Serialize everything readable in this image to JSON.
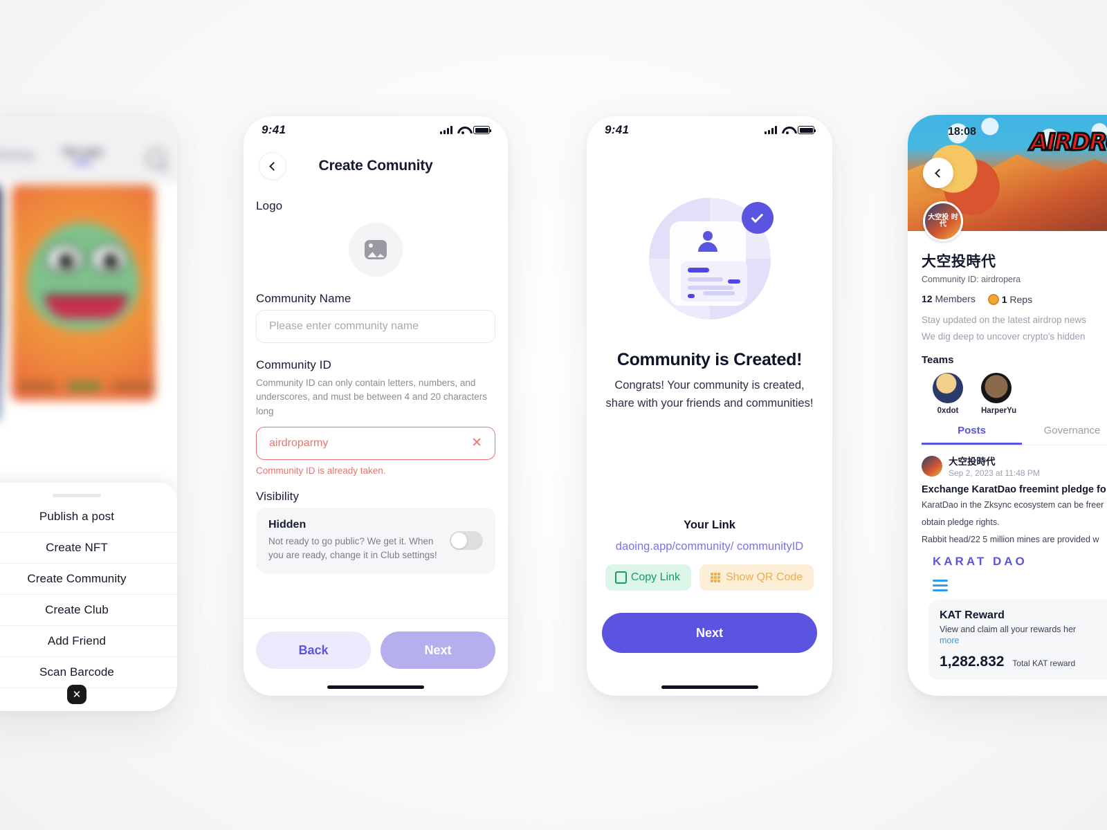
{
  "screen_feed": {
    "status": {
      "time": "",
      "icons": [
        "signal-icon",
        "wifi-icon",
        "battery-icon"
      ]
    },
    "tabs": [
      {
        "label": "Following",
        "active": false
      },
      {
        "label": "For you",
        "active": true
      }
    ],
    "search_icon": "search-icon",
    "sheet": {
      "items": [
        {
          "label": "Publish a post"
        },
        {
          "label": "Create NFT"
        },
        {
          "label": "Create Community"
        },
        {
          "label": "Create Club"
        },
        {
          "label": "Add Friend"
        },
        {
          "label": "Scan Barcode"
        }
      ],
      "close_label": "✕"
    }
  },
  "screen_create": {
    "status": {
      "time": "9:41"
    },
    "nav": {
      "back_icon": "chevron-left-icon",
      "title": "Create Comunity"
    },
    "logo": {
      "label": "Logo",
      "placeholder_icon": "image-placeholder-icon"
    },
    "community_name": {
      "label": "Community Name",
      "placeholder": "Please enter community name",
      "value": ""
    },
    "community_id": {
      "label": "Community ID",
      "hint": "Community ID can only contain letters, numbers, and underscores, and must be between 4 and 20 characters long",
      "value": "airdroparmy",
      "clear_icon": "✕",
      "error": "Community ID is already taken."
    },
    "visibility": {
      "label": "Visibility",
      "option_title": "Hidden",
      "option_sub": "Not ready to go public? We get it. When you are ready, change it in Club settings!",
      "toggle_state": "off"
    },
    "footer": {
      "back_label": "Back",
      "next_label": "Next"
    },
    "colors": {
      "accent": "#5b54e0",
      "error": "#e8746f",
      "next_soft": "#b5afee",
      "back_bg": "#eceafc"
    }
  },
  "screen_done": {
    "status": {
      "time": "9:41"
    },
    "illustration": {
      "icon": "created-check-illustration"
    },
    "title": "Community is Created!",
    "subtitle_line1": "Congrats! Your community is created,",
    "subtitle_line2": "share with your friends and communities!",
    "link_label": "Your Link",
    "link_url": "daoing.app/community/ communityID",
    "copy_button": {
      "label": "Copy Link",
      "icon": "copy-icon",
      "color": "#179b63",
      "bg": "#ddf5e7"
    },
    "qr_button": {
      "label": "Show QR Code",
      "icon": "qr-code-icon",
      "color": "#edae4b",
      "bg": "#fdeed8"
    },
    "next_label": "Next",
    "colors": {
      "accent": "#5b54e0"
    }
  },
  "screen_profile": {
    "status": {
      "time": "18:08"
    },
    "banner": {
      "word": "AIRDROP",
      "back_icon": "chevron-left-icon"
    },
    "avatar_text": "大空投\n时代",
    "name": "大空投時代",
    "community_id": "Community ID: airdropera",
    "members_count": "12",
    "members_label": "Members",
    "reps_count": "1",
    "reps_label": "Reps",
    "reps_icon": "medal-icon",
    "desc_line1": "Stay updated on the latest airdrop news",
    "desc_line2": "We dig deep to uncover crypto's hidden",
    "teams_label": "Teams",
    "teams": [
      {
        "name": "0xdot"
      },
      {
        "name": "HarperYu"
      }
    ],
    "tabs": [
      {
        "label": "Posts",
        "active": true
      },
      {
        "label": "Governance",
        "active": false
      }
    ],
    "post": {
      "author": "大空投時代",
      "timestamp": "Sep 2, 2023 at 11:48 PM",
      "title": "Exchange KaratDao freemint pledge fo",
      "body_line1": "KaratDao in the Zksync ecosystem can be freer",
      "body_line2": "obtain pledge rights.",
      "body_line3": "Rabbit head/22 5 million mines are provided w",
      "brand": "KARAT DAO",
      "menu_icon": "hamburger-icon"
    },
    "kat_card": {
      "title": "KAT Reward",
      "subtitle": "View and claim all your rewards her",
      "more_label": "more",
      "amount": "1,282.832",
      "amount_label": "Total KAT reward"
    },
    "colors": {
      "accent": "#5b54e0",
      "link": "#2f9cf0"
    }
  }
}
